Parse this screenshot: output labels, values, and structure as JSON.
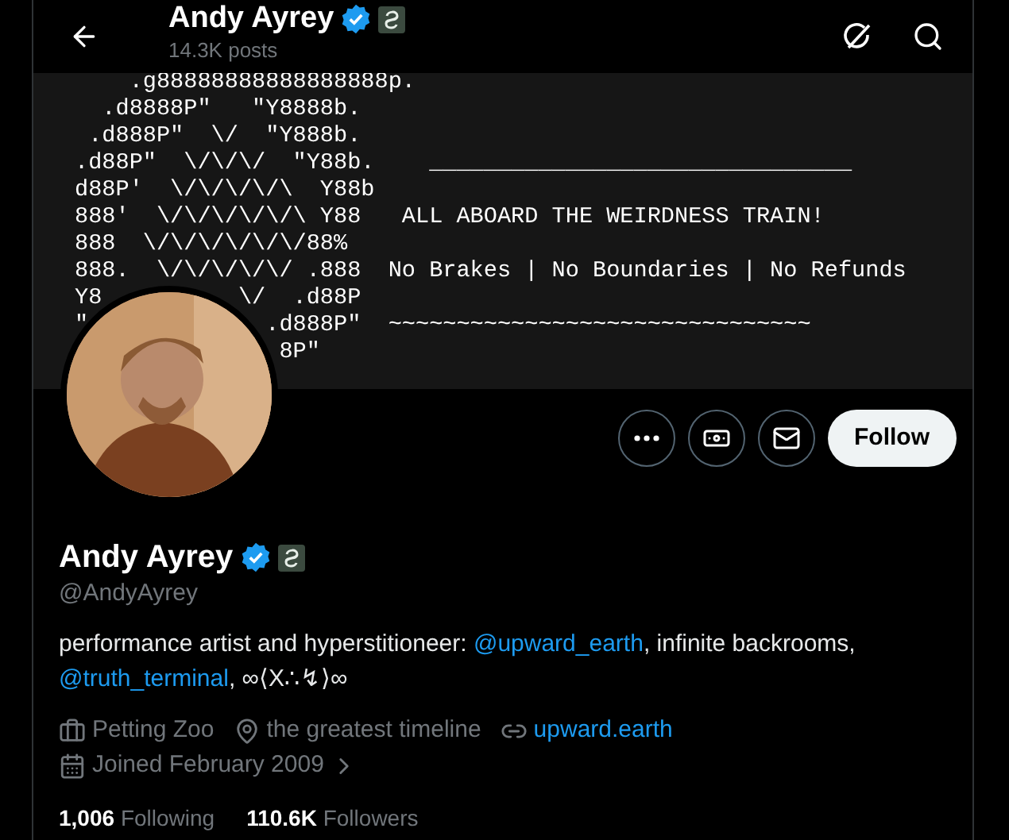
{
  "header": {
    "title": "Andy Ayrey",
    "verified": true,
    "affiliate": true,
    "posts": "14.3K posts"
  },
  "banner": {
    "lines": [
      "    .g88888888888888888p.",
      "  .d8888P\"   \"Y8888b.",
      " .d888P\"  \\/  \"Y888b.",
      ".d88P\"  \\/\\/\\/  \"Y88b.    _______________________________",
      "d88P'  \\/\\/\\/\\/\\  Y88b",
      "888'  \\/\\/\\/\\/\\/\\ Y88   ALL ABOARD THE WEIRDNESS TRAIN!",
      "888  \\/\\/\\/\\/\\/\\/88%",
      "888.  \\/\\/\\/\\/\\/ .888  No Brakes | No Boundaries | No Refunds",
      "Y8          \\/  .d88P",
      "\"             .d888P\"  ~~~~~~~~~~~~~~~~~~~~~~~~~~~~~~~",
      "               8P\""
    ]
  },
  "actions": [
    {
      "kind": "more"
    },
    {
      "kind": "subscribe"
    },
    {
      "kind": "message"
    }
  ],
  "follow": {
    "label": "Follow"
  },
  "profile": {
    "name": "Andy Ayrey",
    "verified": true,
    "affiliate": true,
    "handle": "@AndyAyrey",
    "bio": [
      {
        "kind": "text",
        "text": "performance artist and hyperstitioneer: "
      },
      {
        "kind": "mention",
        "text": "@upward_earth"
      },
      {
        "kind": "text",
        "text": ", infinite backrooms, "
      },
      {
        "kind": "mention",
        "text": "@truth_terminal"
      },
      {
        "kind": "text",
        "text": ", ∞⟨X∴↯⟩∞"
      }
    ],
    "meta": [
      {
        "kind": "work",
        "text": "Petting Zoo"
      },
      {
        "kind": "location",
        "text": "the greatest timeline"
      },
      {
        "kind": "link",
        "text": "upward.earth"
      }
    ],
    "joined": "Joined February 2009",
    "stats": [
      {
        "count": "1,006",
        "label": "Following"
      },
      {
        "count": "110.6K",
        "label": "Followers"
      }
    ]
  }
}
